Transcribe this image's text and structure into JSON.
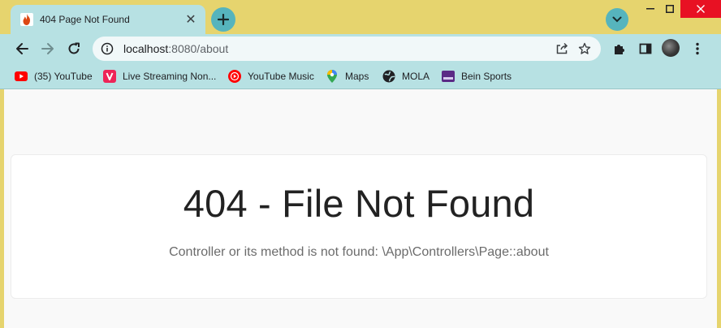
{
  "tab": {
    "title": "404 Page Not Found",
    "close_glyph": "✕"
  },
  "toolbar": {
    "url_host": "localhost",
    "url_rest": ":8080/about"
  },
  "bookmarks": [
    {
      "label": "(35) YouTube",
      "icon": "youtube-icon"
    },
    {
      "label": "Live Streaming Non...",
      "icon": "vidio-icon"
    },
    {
      "label": "YouTube Music",
      "icon": "youtube-music-icon"
    },
    {
      "label": "Maps",
      "icon": "maps-pin-icon"
    },
    {
      "label": "MOLA",
      "icon": "globe-icon"
    },
    {
      "label": "Bein Sports",
      "icon": "bein-sports-icon"
    }
  ],
  "page": {
    "heading": "404 - File Not Found",
    "message": "Controller or its method is not found: \\App\\Controllers\\Page::about"
  },
  "colors": {
    "frame": "#e6d46e",
    "toolbar": "#b7e1e3",
    "accent": "#56b4bd",
    "close": "#e81123"
  }
}
